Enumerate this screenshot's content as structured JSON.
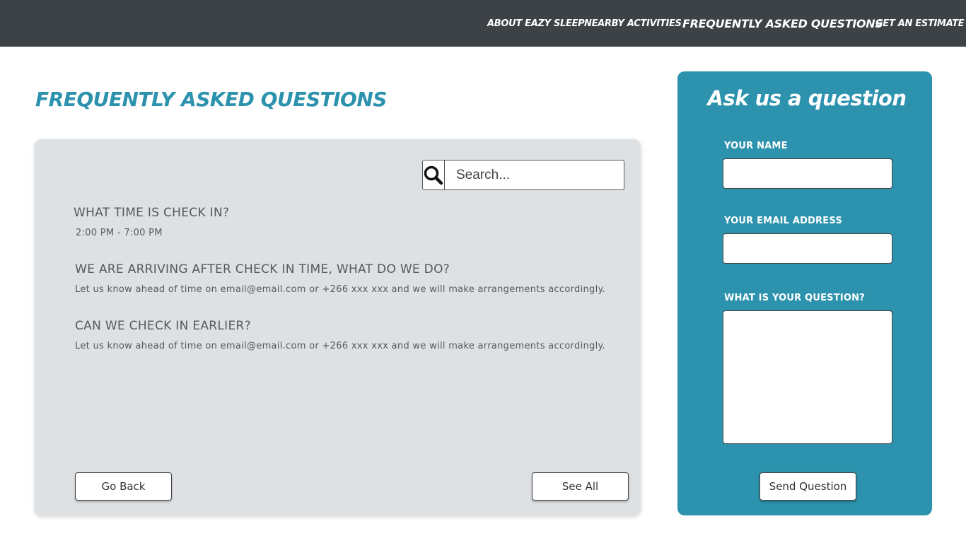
{
  "nav": {
    "items": [
      {
        "label": "ABOUT EAZY SLEEP"
      },
      {
        "label": "NEARBY ACTIVITIES"
      },
      {
        "label": "FREQUENTLY ASKED QUESTIONS"
      },
      {
        "label": "GET AN ESTIMATE"
      }
    ]
  },
  "page_title": "FREQUENTLY ASKED QUESTIONS",
  "search": {
    "placeholder": "Search...",
    "icon": "search-icon"
  },
  "faqs": [
    {
      "question": "WHAT TIME IS CHECK IN?",
      "answer": "2:00 PM - 7:00 PM"
    },
    {
      "question": "WE ARE ARRIVING AFTER CHECK IN TIME, WHAT DO WE DO?",
      "answer": "Let us know ahead of time  on email@email.com or +266 xxx xxx and we will make arrangements accordingly."
    },
    {
      "question": "CAN WE CHECK IN EARLIER?",
      "answer": "Let us know ahead of time on email@email.com or +266 xxx xxx and we will make arrangements accordingly."
    }
  ],
  "buttons": {
    "go_back": "Go Back",
    "see_all": "See All"
  },
  "ask_form": {
    "title": "Ask us a question",
    "name_label": "YOUR NAME",
    "email_label": "YOUR EMAIL ADDRESS",
    "question_label": "WHAT IS YOUR QUESTION?",
    "name_value": "",
    "email_value": "",
    "question_value": "",
    "submit_label": "Send Question"
  },
  "colors": {
    "topbar": "#3d4246",
    "accent": "#2c92ad",
    "panel": "#dee1e4"
  }
}
